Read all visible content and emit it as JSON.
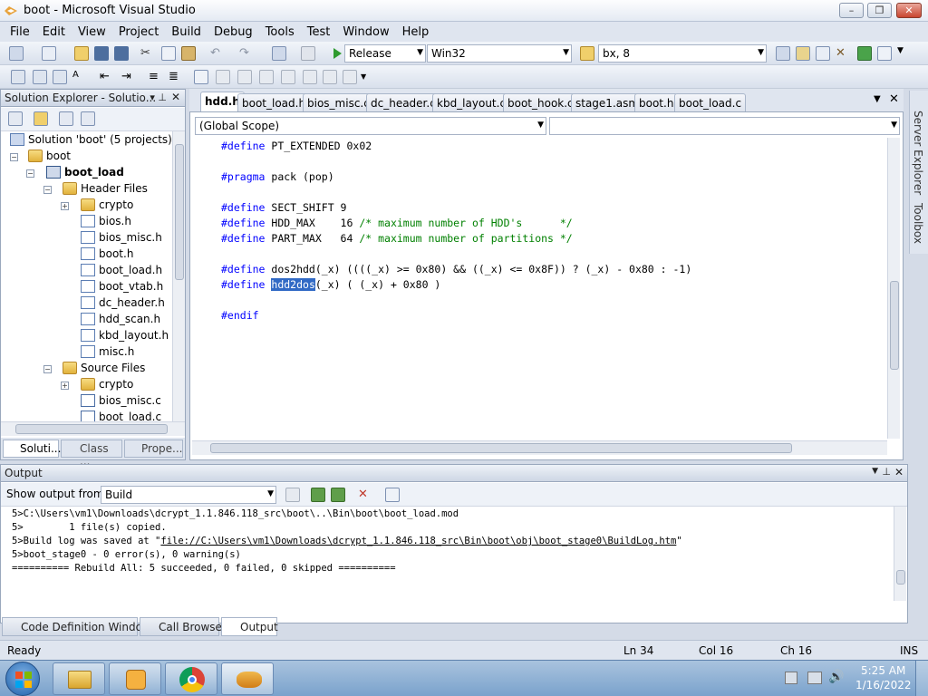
{
  "window": {
    "title": "boot - Microsoft Visual Studio",
    "min": "–",
    "max": "❐",
    "close": "✕"
  },
  "menu": [
    "File",
    "Edit",
    "View",
    "Project",
    "Build",
    "Debug",
    "Tools",
    "Test",
    "Window",
    "Help"
  ],
  "toolbar": {
    "config": "Release",
    "platform": "Win32",
    "find": "bx, 8"
  },
  "solution_explorer": {
    "title": "Solution Explorer - Solutio...",
    "pin": "▾ ⊥",
    "close": "✕",
    "root": "Solution 'boot' (5 projects)",
    "items": [
      {
        "label": "boot",
        "indent": 0
      },
      {
        "label": "boot_load",
        "indent": 1
      },
      {
        "label": "Header Files",
        "indent": 2
      },
      {
        "label": "crypto",
        "indent": 3
      },
      {
        "label": "bios.h",
        "indent": 3
      },
      {
        "label": "bios_misc.h",
        "indent": 3
      },
      {
        "label": "boot.h",
        "indent": 3
      },
      {
        "label": "boot_load.h",
        "indent": 3
      },
      {
        "label": "boot_vtab.h",
        "indent": 3
      },
      {
        "label": "dc_header.h",
        "indent": 3
      },
      {
        "label": "hdd_scan.h",
        "indent": 3
      },
      {
        "label": "kbd_layout.h",
        "indent": 3
      },
      {
        "label": "misc.h",
        "indent": 3
      },
      {
        "label": "Source Files",
        "indent": 2
      },
      {
        "label": "crypto",
        "indent": 3
      },
      {
        "label": "bios_misc.c",
        "indent": 3
      },
      {
        "label": "boot_load.c",
        "indent": 3
      }
    ],
    "tabs": [
      "Soluti...",
      "Class ...",
      "Prope..."
    ]
  },
  "editor": {
    "tabs": [
      "hdd.h",
      "boot_load.h",
      "bios_misc.c",
      "dc_header.c",
      "kbd_layout.c",
      "boot_hook.c",
      "stage1.asm",
      "boot.h",
      "boot_load.c"
    ],
    "scope": "(Global Scope)",
    "lines": {
      "l1a": "#define",
      "l1b": " PT_EXTENDED 0x02",
      "l2a": "#pragma",
      "l2b": " pack (pop)",
      "l3a": "#define",
      "l3b": " SECT_SHIFT 9",
      "l4a": "#define",
      "l4b": " HDD_MAX    16 ",
      "l4c": "/* maximum number of HDD's      */",
      "l5a": "#define",
      "l5b": " PART_MAX   64 ",
      "l5c": "/* maximum number of partitions */",
      "l6a": "#define",
      "l6b": " dos2hdd(_x) ((((_x) >= 0x80) && ((_x) <= 0x8F)) ? (_x) - 0x80 : -1)",
      "l7a": "#define",
      "l7b": " ",
      "l7hl": "hdd2dos",
      "l7c": "(_x) ( (_x) + 0x80 )",
      "l8a": "#endif"
    }
  },
  "output": {
    "title": "Output",
    "show_from_label": "Show output from:",
    "show_from": "Build",
    "lines": [
      "5>C:\\Users\\vm1\\Downloads\\dcrypt_1.1.846.118_src\\boot\\..\\Bin\\boot\\boot_load.mod",
      "5>        1 file(s) copied.",
      "5>boot_stage0 - 0 error(s), 0 warning(s)",
      "========== Rebuild All: 5 succeeded, 0 failed, 0 skipped =========="
    ],
    "build_log_prefix": "5>Build log was saved at \"",
    "build_log_link": "file://C:\\Users\\vm1\\Downloads\\dcrypt_1.1.846.118_src\\Bin\\boot\\obj\\boot_stage0\\BuildLog.htm",
    "build_log_suffix": "\""
  },
  "bottom_tabs": [
    "Code Definition Window",
    "Call Browser",
    "Output"
  ],
  "status": {
    "ready": "Ready",
    "ln": "Ln 34",
    "col": "Col 16",
    "ch": "Ch 16",
    "ins": "INS"
  },
  "side": {
    "server": "Server Explorer",
    "toolbox": "Toolbox"
  },
  "taskbar": {
    "time": "5:25 AM",
    "date": "1/16/2022"
  }
}
